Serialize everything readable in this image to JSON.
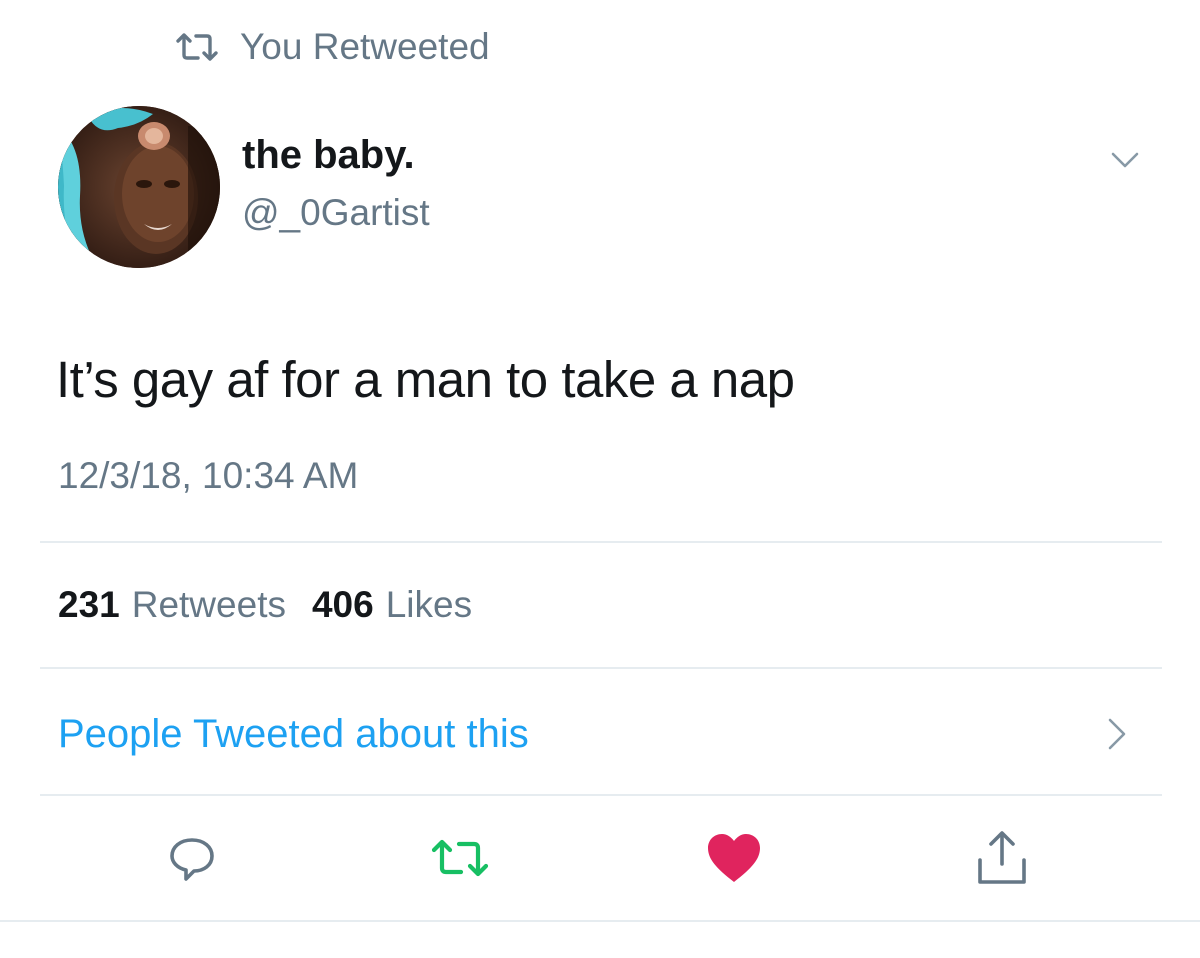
{
  "context": {
    "label": "You Retweeted",
    "icon": "retweet-icon",
    "color": "#657786"
  },
  "tweet": {
    "author_name": "the baby.",
    "author_handle": "@_0Gartist",
    "text": "It’s gay af for a man to take a nap",
    "timestamp": "12/3/18, 10:34 AM"
  },
  "stats": {
    "retweets_count": "231",
    "retweets_label": "Retweets",
    "likes_count": "406",
    "likes_label": "Likes"
  },
  "related": {
    "label": "People Tweeted about this",
    "color": "#1da1f2"
  },
  "actions": [
    {
      "icon": "reply-icon",
      "color": "#657786"
    },
    {
      "icon": "retweet-icon",
      "color": "#17bf63",
      "active": true
    },
    {
      "icon": "heart-icon",
      "color": "#e0245e",
      "active": true
    },
    {
      "icon": "share-icon",
      "color": "#657786"
    }
  ],
  "colors": {
    "text": "#14171a",
    "secondary": "#657786",
    "divider": "#e6ecf0"
  }
}
